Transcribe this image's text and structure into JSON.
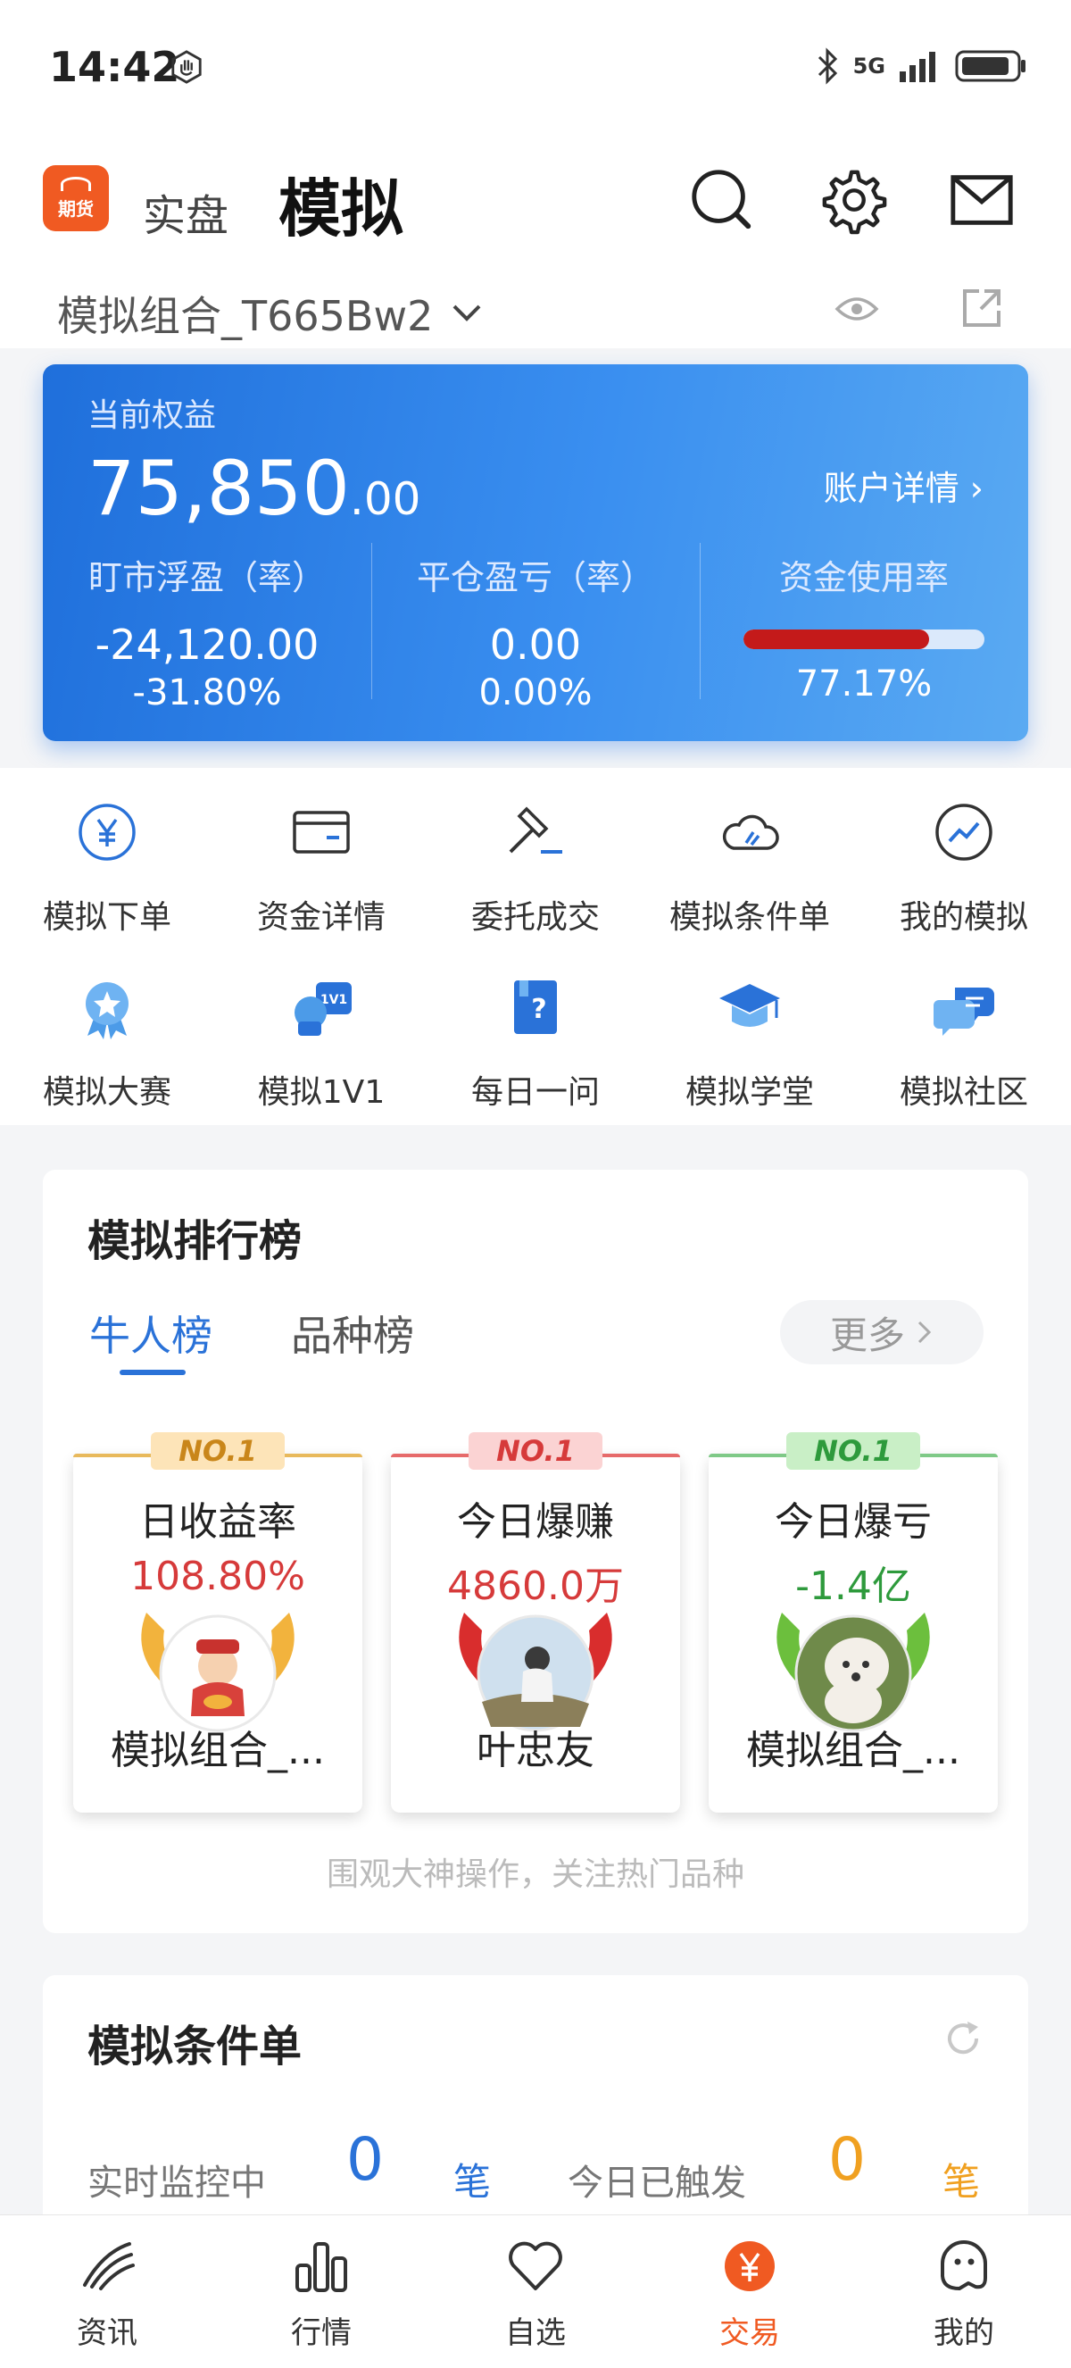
{
  "status_bar": {
    "time": "14:42",
    "network": "5G"
  },
  "header": {
    "logo_text": "期货",
    "tab_real": "实盘",
    "tab_sim": "模拟",
    "portfolio_name": "模拟组合_T665Bw2"
  },
  "account": {
    "label": "当前权益",
    "balance_int": "75,850",
    "balance_dec": ".00",
    "detail_link": "账户详情",
    "stats": [
      {
        "title": "盯市浮盈（率）",
        "value": "-24,120.00",
        "sub": "-31.80%"
      },
      {
        "title": "平仓盈亏（率）",
        "value": "0.00",
        "sub": "0.00%"
      },
      {
        "title": "资金使用率",
        "sub": "77.17%",
        "usage_fraction": 0.7717
      }
    ]
  },
  "menu": [
    {
      "label": "模拟下单",
      "icon": "yen-circle-icon"
    },
    {
      "label": "资金详情",
      "icon": "wallet-card-icon"
    },
    {
      "label": "委托成交",
      "icon": "gavel-icon"
    },
    {
      "label": "模拟条件单",
      "icon": "cloud-icon"
    },
    {
      "label": "我的模拟",
      "icon": "trend-circle-icon"
    },
    {
      "label": "模拟大赛",
      "icon": "medal-icon"
    },
    {
      "label": "模拟1V1",
      "icon": "versus-icon"
    },
    {
      "label": "每日一问",
      "icon": "question-book-icon"
    },
    {
      "label": "模拟学堂",
      "icon": "graduation-cap-icon"
    },
    {
      "label": "模拟社区",
      "icon": "chat-bubble-icon"
    }
  ],
  "ranking": {
    "title": "模拟排行榜",
    "tab_active": "牛人榜",
    "tab_other": "品种榜",
    "more": "更多",
    "badge": "NO.1",
    "cards": [
      {
        "title": "日收益率",
        "value": "108.80%",
        "name": "模拟组合_...",
        "color": "#d63a3a",
        "accent": "#e8b95c",
        "badge_bg": "#fde4b8",
        "badge_fg": "#c9861a"
      },
      {
        "title": "今日爆赚",
        "value": "4860.0万",
        "name": "叶忠友",
        "color": "#d63a3a",
        "accent": "#e66a6a",
        "badge_bg": "#fbd3d3",
        "badge_fg": "#d63a3a"
      },
      {
        "title": "今日爆亏",
        "value": "-1.4亿",
        "name": "模拟组合_...",
        "color": "#2e9a3c",
        "accent": "#7fc987",
        "badge_bg": "#c9efc6",
        "badge_fg": "#2e9a3c"
      }
    ],
    "footer": "围观大神操作，关注热门品种"
  },
  "condition": {
    "title": "模拟条件单",
    "monitoring_label": "实时监控中",
    "monitoring_count": "0",
    "monitoring_unit": "笔",
    "triggered_label": "今日已触发",
    "triggered_count": "0",
    "triggered_unit": "笔"
  },
  "bottom_nav": [
    {
      "label": "资讯",
      "icon": "news-icon"
    },
    {
      "label": "行情",
      "icon": "bar-chart-icon"
    },
    {
      "label": "自选",
      "icon": "heart-icon"
    },
    {
      "label": "交易",
      "icon": "trade-yen-icon"
    },
    {
      "label": "我的",
      "icon": "profile-ghost-icon"
    }
  ],
  "colors": {
    "accent": "#f05a22",
    "blue": "#2a72d8",
    "red": "#d63a3a",
    "green": "#2e9a3c",
    "orange": "#f0a020"
  }
}
